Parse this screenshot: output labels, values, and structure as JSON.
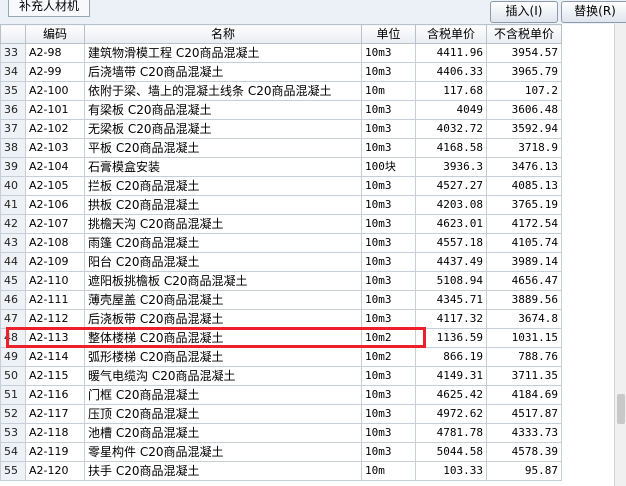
{
  "tabs": {
    "supplementary_materials": "补充人材机"
  },
  "toolbar": {
    "insert_label": "插入(I)",
    "replace_label": "替换(R)"
  },
  "table": {
    "columns": [
      "",
      "编码",
      "名称",
      "单位",
      "含税单价",
      "不含税单价"
    ],
    "rows": [
      {
        "idx": "33",
        "code": "A2-98",
        "name": "建筑物滑模工程 C20商品混凝土",
        "unit": "10m3",
        "tax_price": "4411.96",
        "notax_price": "3954.57"
      },
      {
        "idx": "34",
        "code": "A2-99",
        "name": "后浇墙带 C20商品混凝土",
        "unit": "10m3",
        "tax_price": "4406.33",
        "notax_price": "3965.79"
      },
      {
        "idx": "35",
        "code": "A2-100",
        "name": "依附于梁、墙上的混凝土线条 C20商品混凝土",
        "unit": "10m",
        "tax_price": "117.68",
        "notax_price": "107.2"
      },
      {
        "idx": "36",
        "code": "A2-101",
        "name": "有梁板 C20商品混凝土",
        "unit": "10m3",
        "tax_price": "4049",
        "notax_price": "3606.48"
      },
      {
        "idx": "37",
        "code": "A2-102",
        "name": "无梁板 C20商品混凝土",
        "unit": "10m3",
        "tax_price": "4032.72",
        "notax_price": "3592.94"
      },
      {
        "idx": "38",
        "code": "A2-103",
        "name": "平板 C20商品混凝土",
        "unit": "10m3",
        "tax_price": "4168.58",
        "notax_price": "3718.9"
      },
      {
        "idx": "39",
        "code": "A2-104",
        "name": "石膏模盒安装",
        "unit": "100块",
        "tax_price": "3936.3",
        "notax_price": "3476.13"
      },
      {
        "idx": "40",
        "code": "A2-105",
        "name": "拦板 C20商品混凝土",
        "unit": "10m3",
        "tax_price": "4527.27",
        "notax_price": "4085.13"
      },
      {
        "idx": "41",
        "code": "A2-106",
        "name": "拱板 C20商品混凝土",
        "unit": "10m3",
        "tax_price": "4203.08",
        "notax_price": "3765.19"
      },
      {
        "idx": "42",
        "code": "A2-107",
        "name": "挑檐天沟 C20商品混凝土",
        "unit": "10m3",
        "tax_price": "4623.01",
        "notax_price": "4172.54"
      },
      {
        "idx": "43",
        "code": "A2-108",
        "name": "雨篷 C20商品混凝土",
        "unit": "10m3",
        "tax_price": "4557.18",
        "notax_price": "4105.74"
      },
      {
        "idx": "44",
        "code": "A2-109",
        "name": "阳台 C20商品混凝土",
        "unit": "10m3",
        "tax_price": "4437.49",
        "notax_price": "3989.14"
      },
      {
        "idx": "45",
        "code": "A2-110",
        "name": "遮阳板挑檐板 C20商品混凝土",
        "unit": "10m3",
        "tax_price": "5108.94",
        "notax_price": "4656.47"
      },
      {
        "idx": "46",
        "code": "A2-111",
        "name": "薄壳屋盖 C20商品混凝土",
        "unit": "10m3",
        "tax_price": "4345.71",
        "notax_price": "3889.56"
      },
      {
        "idx": "47",
        "code": "A2-112",
        "name": "后浇板带 C20商品混凝土",
        "unit": "10m3",
        "tax_price": "4117.32",
        "notax_price": "3674.8"
      },
      {
        "idx": "48",
        "code": "A2-113",
        "name": "整体楼梯 C20商品混凝土",
        "unit": "10m2",
        "tax_price": "1136.59",
        "notax_price": "1031.15"
      },
      {
        "idx": "49",
        "code": "A2-114",
        "name": "弧形楼梯 C20商品混凝土",
        "unit": "10m2",
        "tax_price": "866.19",
        "notax_price": "788.76"
      },
      {
        "idx": "50",
        "code": "A2-115",
        "name": "暖气电缆沟 C20商品混凝土",
        "unit": "10m3",
        "tax_price": "4149.31",
        "notax_price": "3711.35"
      },
      {
        "idx": "51",
        "code": "A2-116",
        "name": "门框 C20商品混凝土",
        "unit": "10m3",
        "tax_price": "4625.42",
        "notax_price": "4184.69"
      },
      {
        "idx": "52",
        "code": "A2-117",
        "name": "压顶 C20商品混凝土",
        "unit": "10m3",
        "tax_price": "4972.62",
        "notax_price": "4517.87"
      },
      {
        "idx": "53",
        "code": "A2-118",
        "name": "池槽 C20商品混凝土",
        "unit": "10m3",
        "tax_price": "4781.78",
        "notax_price": "4333.73"
      },
      {
        "idx": "54",
        "code": "A2-119",
        "name": "零星构件 C20商品混凝土",
        "unit": "10m3",
        "tax_price": "5044.58",
        "notax_price": "4578.39"
      },
      {
        "idx": "55",
        "code": "A2-120",
        "name": "扶手 C20商品混凝土",
        "unit": "10m",
        "tax_price": "103.33",
        "notax_price": "95.87"
      }
    ]
  },
  "highlight_color": "#ec1f2a",
  "highlighted_row_index": "48"
}
